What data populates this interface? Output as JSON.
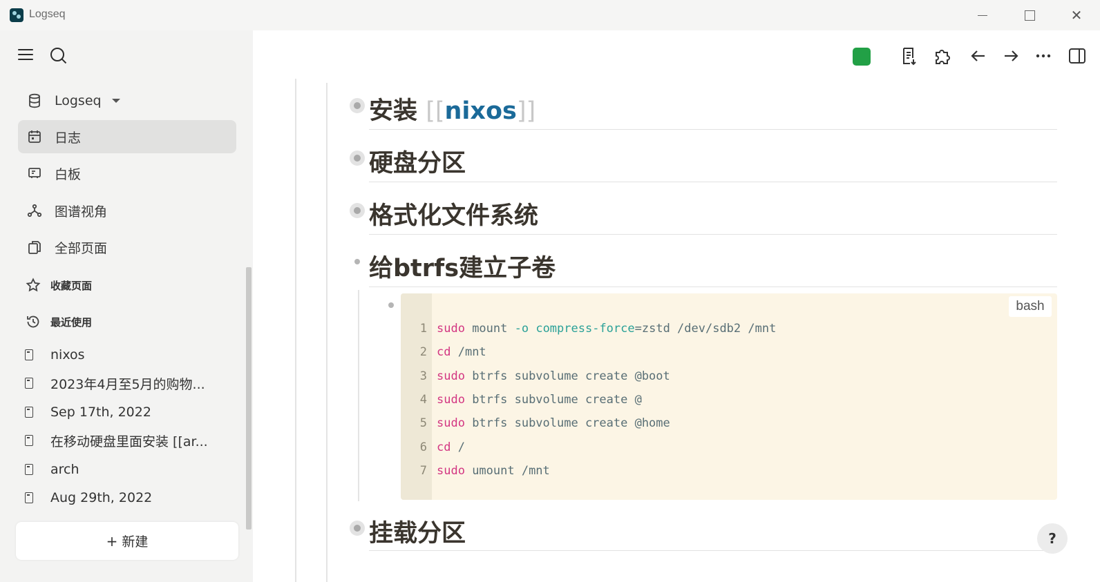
{
  "window": {
    "title": "Logseq"
  },
  "sidebar": {
    "graph": {
      "label": "Logseq"
    },
    "nav": [
      {
        "label": "日志",
        "icon": "calendar-icon",
        "active": true
      },
      {
        "label": "白板",
        "icon": "whiteboard-icon"
      },
      {
        "label": "图谱视角",
        "icon": "graph-icon"
      },
      {
        "label": "全部页面",
        "icon": "pages-icon"
      }
    ],
    "favorites": {
      "label": "收藏页面"
    },
    "recent": {
      "label": "最近使用",
      "items": [
        "nixos",
        "2023年4月至5月的购物...",
        "Sep 17th, 2022",
        "在移动硬盘里面安装 [[ar...",
        "arch",
        "Aug 29th, 2022"
      ]
    },
    "new_button": {
      "plus": "+",
      "label": "新建"
    }
  },
  "main": {
    "blocks": [
      {
        "text": "安装",
        "link_open": "[[",
        "link": "nixos",
        "link_close": "]]"
      },
      {
        "text": "硬盘分区"
      },
      {
        "text": "格式化文件系统"
      },
      {
        "text": "给btrfs建立子卷"
      },
      {
        "text": "挂载分区"
      }
    ],
    "code": {
      "language": "bash",
      "lines": [
        {
          "n": "1",
          "tokens": [
            [
              "kw",
              "sudo"
            ],
            [
              "",
              "mount"
            ],
            [
              "op",
              "-o"
            ],
            [
              "op",
              "compress-force"
            ],
            [
              "",
              "=zstd /dev/sdb2 /mnt"
            ]
          ]
        },
        {
          "n": "2",
          "tokens": [
            [
              "kw",
              "cd"
            ],
            [
              "",
              "/mnt"
            ]
          ]
        },
        {
          "n": "3",
          "tokens": [
            [
              "kw",
              "sudo"
            ],
            [
              "",
              "btrfs subvolume create @boot"
            ]
          ]
        },
        {
          "n": "4",
          "tokens": [
            [
              "kw",
              "sudo"
            ],
            [
              "",
              "btrfs subvolume create @"
            ]
          ]
        },
        {
          "n": "5",
          "tokens": [
            [
              "kw",
              "sudo"
            ],
            [
              "",
              "btrfs subvolume create @home"
            ]
          ]
        },
        {
          "n": "6",
          "tokens": [
            [
              "kw",
              "cd"
            ],
            [
              "",
              "/"
            ]
          ]
        },
        {
          "n": "7",
          "tokens": [
            [
              "kw",
              "sudo"
            ],
            [
              "",
              "umount /mnt"
            ]
          ]
        }
      ]
    },
    "help": "?"
  },
  "colors": {
    "accent_link": "#1b6a99",
    "sync_status": "#22a046",
    "code_bg": "#fcf5e5",
    "keyword": "#d33682"
  }
}
